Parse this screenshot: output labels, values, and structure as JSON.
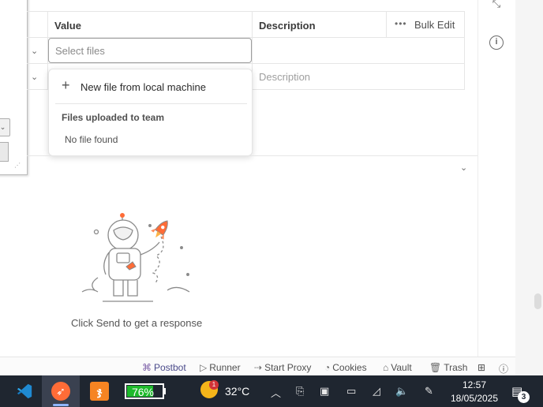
{
  "table": {
    "header": {
      "value": "Value",
      "description": "Description",
      "bulk_edit": "Bulk Edit",
      "more": "•••"
    },
    "rows": [
      {
        "value_placeholder": "Select files",
        "description": ""
      },
      {
        "value_placeholder": "",
        "description_placeholder": "Description"
      }
    ]
  },
  "file_dropdown": {
    "new_file": "New file from local machine",
    "section_title": "Files uploaded to team",
    "empty_text": "No file found"
  },
  "response": {
    "empty_text": "Click Send to get a response"
  },
  "status_bar": {
    "items": [
      "Postbot",
      "Runner",
      "Start Proxy",
      "Cookies",
      "Vault",
      "Trash"
    ]
  },
  "taskbar": {
    "battery_percent": "76%",
    "battery_level": 0.76,
    "weather_temp": "32°C",
    "weather_badge": "1",
    "time": "12:57",
    "date": "18/05/2025",
    "notification_count": "3"
  },
  "colors": {
    "postman_orange": "#ff6c37",
    "battery_green": "#1db92b",
    "taskbar_bg": "#1f2630"
  }
}
